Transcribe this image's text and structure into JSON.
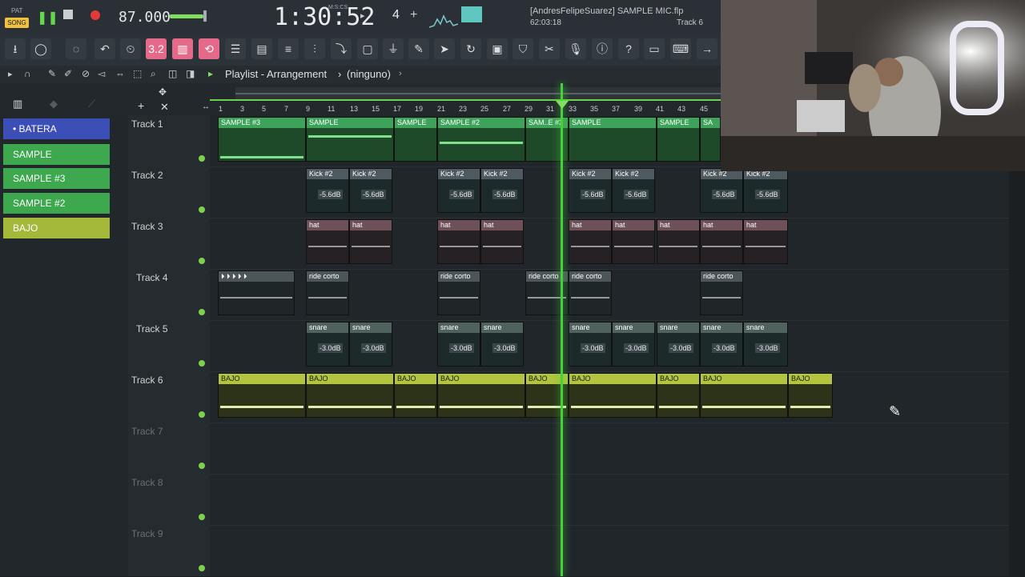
{
  "transport": {
    "pat_label": "PAT",
    "song_label": "SONG",
    "tempo": "87.000",
    "time": "1:30:52",
    "time_unit": "M:S:CS",
    "pattern_num": "4",
    "project_title": "[AndresFelipeSuarez] SAMPLE MIC.flp",
    "time_info": "62:03:18",
    "hint_track": "Track 6"
  },
  "toolbar": {
    "snap_label": "3.2",
    "icons": [
      "download-icon",
      "knob-icon",
      "metronome-icon",
      "undo-icon",
      "wait-icon",
      "record-icon",
      "loop-icon",
      "playlist-icon",
      "piano-icon",
      "mixer-icon",
      "channel-icon",
      "browser-icon",
      "plugin-icon",
      "brush-icon",
      "arrow-icon",
      "refresh-icon",
      "save-icon",
      "tag-icon",
      "cut-icon",
      "mic-icon",
      "info-icon",
      "help-icon",
      "window-icon",
      "keyboard-icon",
      "next-icon"
    ]
  },
  "playlist": {
    "header": "Playlist - Arrangement",
    "pattern": "(ninguno)"
  },
  "picker": [
    {
      "label": "BATERA",
      "color": "#3b4fb6"
    },
    {
      "label": "SAMPLE",
      "color": "#3ea84f"
    },
    {
      "label": "SAMPLE #3",
      "color": "#3ea84f"
    },
    {
      "label": "SAMPLE #2",
      "color": "#3ea84f"
    },
    {
      "label": "BAJO",
      "color": "#a4b83a"
    }
  ],
  "ruler": [
    "1",
    "3",
    "5",
    "7",
    "9",
    "11",
    "13",
    "15",
    "17",
    "19",
    "21",
    "23",
    "25",
    "27",
    "29",
    "31",
    "33",
    "35",
    "37",
    "39",
    "41",
    "43",
    "45"
  ],
  "tracks": [
    "Track 1",
    "Track 2",
    "Track 3",
    "Track 4",
    "Track 5",
    "Track 6",
    "Track 7",
    "Track 8",
    "Track 9"
  ],
  "clips": {
    "t1": [
      "SAMPLE #3",
      "SAMPLE",
      "SAMPLE",
      "SAMPLE #2",
      "SAM..E #3",
      "SAMPLE",
      "SAMPLE",
      "SA"
    ],
    "t2": [
      "Kick #2",
      "Kick #2",
      "Kick #2",
      "Kick #2",
      "Kick #2",
      "Kick #2",
      "Kick #2",
      "Kick #2"
    ],
    "t2_db": "-5.6dB",
    "t3": [
      "hat",
      "hat",
      "hat",
      "hat",
      "hat",
      "hat",
      "hat",
      "hat",
      "hat",
      "hat"
    ],
    "t4": [
      "ride corto",
      "ride corto",
      "ride corto",
      "ride corto",
      "ride corto"
    ],
    "t5": [
      "snare",
      "snare",
      "snare",
      "snare",
      "snare",
      "snare",
      "snare",
      "snare",
      "snare"
    ],
    "t5_db": "-3.0dB",
    "t6": [
      "BAJO",
      "BAJO",
      "BAJO",
      "BAJO",
      "BAJO",
      "BAJO",
      "BAJO",
      "BAJO",
      "BAJO",
      "BAJO",
      "BAJO"
    ]
  },
  "colors": {
    "accent": "#45d13a",
    "sample": "#3ea35a",
    "bajo": "#b3c43e",
    "pink_button": "#e56a8a"
  }
}
